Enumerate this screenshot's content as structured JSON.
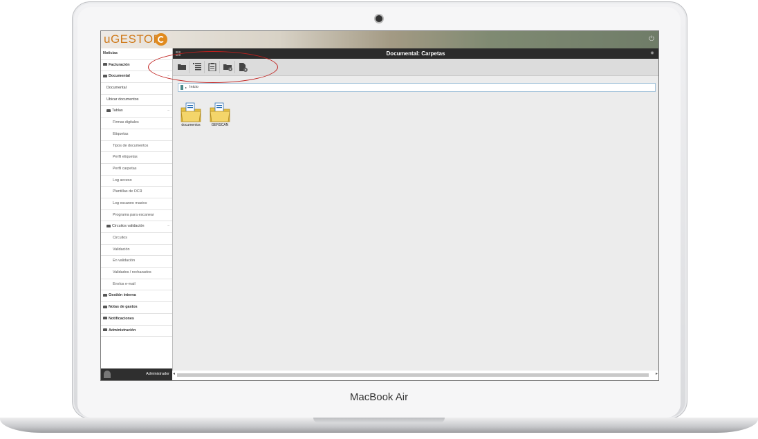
{
  "device": {
    "brand": "MacBook Air"
  },
  "app": {
    "logo_text": "uGESTOR"
  },
  "window": {
    "title": "Documental: Carpetas"
  },
  "sidebar": {
    "items": [
      {
        "label": "Noticias",
        "level": 0,
        "icon": ""
      },
      {
        "label": "Facturación",
        "level": 0,
        "icon": "folder-icon"
      },
      {
        "label": "Documental",
        "level": 0,
        "icon": "folder-icon",
        "expanded": true
      },
      {
        "label": "Documental",
        "level": 1,
        "icon": ""
      },
      {
        "label": "Ubicar documentos",
        "level": 1,
        "icon": ""
      },
      {
        "label": "Tablas",
        "level": 1,
        "icon": "folder-icon",
        "expanded": true
      },
      {
        "label": "Firmas digitales",
        "level": 2,
        "icon": ""
      },
      {
        "label": "Etiquetas",
        "level": 2,
        "icon": ""
      },
      {
        "label": "Tipos de documentos",
        "level": 2,
        "icon": ""
      },
      {
        "label": "Perfil etiquetas",
        "level": 2,
        "icon": ""
      },
      {
        "label": "Perfil carpetas",
        "level": 2,
        "icon": ""
      },
      {
        "label": "Log acceso",
        "level": 2,
        "icon": ""
      },
      {
        "label": "Plantillas de OCR",
        "level": 2,
        "icon": ""
      },
      {
        "label": "Log escaneo masivo",
        "level": 2,
        "icon": ""
      },
      {
        "label": "Programa para escanear",
        "level": 2,
        "icon": ""
      },
      {
        "label": "Circuitos validación",
        "level": 1,
        "icon": "folder-icon",
        "expanded": true
      },
      {
        "label": "Circuitos",
        "level": 2,
        "icon": ""
      },
      {
        "label": "Validación",
        "level": 2,
        "icon": ""
      },
      {
        "label": "En validación",
        "level": 2,
        "icon": ""
      },
      {
        "label": "Validados / rechazados",
        "level": 2,
        "icon": ""
      },
      {
        "label": "Envíos e-mail",
        "level": 2,
        "icon": ""
      },
      {
        "label": "Gestión interna",
        "level": 0,
        "icon": "folder-icon"
      },
      {
        "label": "Notas de gastos",
        "level": 0,
        "icon": "folder-icon"
      },
      {
        "label": "Notificaciones",
        "level": 0,
        "icon": "folder-icon"
      },
      {
        "label": "Administración",
        "level": 0,
        "icon": "folder-icon"
      }
    ],
    "user": "Administrador"
  },
  "toolbar": {
    "buttons": [
      {
        "name": "folder-open-button",
        "icon": "folder-icon"
      },
      {
        "name": "list-view-button",
        "icon": "list-icon"
      },
      {
        "name": "clipboard-button",
        "icon": "clipboard-icon"
      },
      {
        "name": "folder-settings-button",
        "icon": "folder-gear-icon"
      },
      {
        "name": "document-settings-button",
        "icon": "document-gear-icon"
      }
    ]
  },
  "breadcrumb": {
    "label": "Inicio"
  },
  "folders": [
    {
      "label": "documentos"
    },
    {
      "label": "GERSCAN"
    }
  ],
  "colors": {
    "accent": "#cf7a1b",
    "highlight": "#c0201e",
    "titlebar": "#2b2b2b"
  }
}
